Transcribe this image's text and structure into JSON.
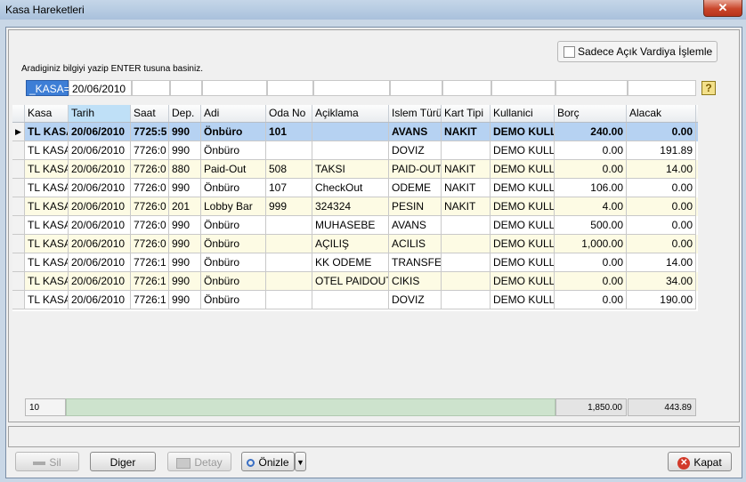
{
  "window": {
    "title": "Kasa Hareketleri",
    "close_label": "✕"
  },
  "filter": {
    "only_open_shift_label": "Sadece Açık Vardiya İşlemle",
    "hint": "Aradiginiz bilgiyi yazip ENTER tusuna basiniz.",
    "kasa_value": "_KASA=",
    "tarih_value": "20/06/2010"
  },
  "grid": {
    "columns": [
      "Kasa",
      "Tarih",
      "Saat",
      "Dep.",
      "Adi",
      "Oda No",
      "Açiklama",
      "Islem Türü",
      "Kart Tipi",
      "Kullanici",
      "Borç",
      "Alacak"
    ],
    "rows": [
      [
        "TL KASA",
        "20/06/2010",
        "7725:5",
        "990",
        "Önbüro",
        "101",
        "",
        "AVANS",
        "NAKIT",
        "DEMO KULL",
        "240.00",
        "0.00"
      ],
      [
        "TL KASA",
        "20/06/2010",
        "7726:0",
        "990",
        "Önbüro",
        "",
        "",
        "DOVIZ",
        "",
        "DEMO KULL",
        "0.00",
        "191.89"
      ],
      [
        "TL KASA",
        "20/06/2010",
        "7726:0",
        "880",
        "Paid-Out",
        "508",
        "TAKSI",
        "PAID-OUT",
        "NAKIT",
        "DEMO KULL",
        "0.00",
        "14.00"
      ],
      [
        "TL KASA",
        "20/06/2010",
        "7726:0",
        "990",
        "Önbüro",
        "107",
        "CheckOut",
        "ODEME",
        "NAKIT",
        "DEMO KULL",
        "106.00",
        "0.00"
      ],
      [
        "TL KASA",
        "20/06/2010",
        "7726:0",
        "201",
        "Lobby Bar",
        "999",
        "324324",
        "PESIN",
        "NAKIT",
        "DEMO KULL",
        "4.00",
        "0.00"
      ],
      [
        "TL KASA",
        "20/06/2010",
        "7726:0",
        "990",
        "Önbüro",
        "",
        "MUHASEBE",
        "AVANS",
        "",
        "DEMO KULL",
        "500.00",
        "0.00"
      ],
      [
        "TL KASA",
        "20/06/2010",
        "7726:0",
        "990",
        "Önbüro",
        "",
        "AÇILIŞ",
        "ACILIS",
        "",
        "DEMO KULL",
        "1,000.00",
        "0.00"
      ],
      [
        "TL KASA",
        "20/06/2010",
        "7726:1",
        "990",
        "Önbüro",
        "",
        "KK ODEME",
        "TRANSFE",
        "",
        "DEMO KULL",
        "0.00",
        "14.00"
      ],
      [
        "TL KASA",
        "20/06/2010",
        "7726:1",
        "990",
        "Önbüro",
        "",
        "OTEL PAIDOUT",
        "CIKIS",
        "",
        "DEMO KULL",
        "0.00",
        "34.00"
      ],
      [
        "TL KASA",
        "20/06/2010",
        "7726:1",
        "990",
        "Önbüro",
        "",
        "",
        "DOVIZ",
        "",
        "DEMO KULL",
        "0.00",
        "190.00"
      ]
    ],
    "footer": {
      "count": "10",
      "borc_total": "1,850.00",
      "alacak_total": "443.89"
    }
  },
  "buttons": {
    "sil": "Sil",
    "diger": "Diger",
    "detay": "Detay",
    "onizle": "Önizle",
    "kapat": "Kapat"
  },
  "colors": {
    "selected_row": "#b6d2f2",
    "alt_row": "#fdfbe4",
    "footer_bar": "#cde3cd"
  }
}
